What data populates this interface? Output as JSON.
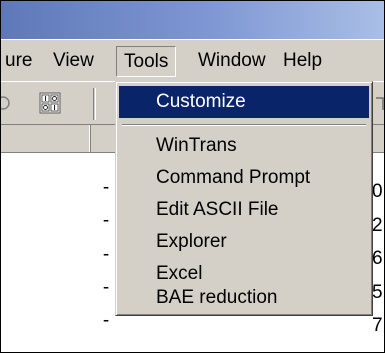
{
  "menubar": {
    "items": [
      {
        "label": "ure"
      },
      {
        "label": "View"
      },
      {
        "label": "Tools"
      },
      {
        "label": "Window"
      },
      {
        "label": "Help"
      }
    ]
  },
  "tools_menu": {
    "items": [
      {
        "label": "Customize",
        "highlighted": true
      },
      {
        "label": "WinTrans"
      },
      {
        "label": "Command Prompt"
      },
      {
        "label": "Edit ASCII File"
      },
      {
        "label": "Explorer"
      },
      {
        "label": "Excel"
      },
      {
        "label": "BAE reduction"
      }
    ]
  },
  "list": {
    "dash_values": [
      "-",
      "-",
      "-",
      "-",
      "-"
    ],
    "right_digits": [
      "0",
      "2",
      "6",
      "5",
      "7"
    ]
  },
  "colors": {
    "titlebar_start": "#5f78b8",
    "titlebar_end": "#a9bfe6",
    "chrome": "#d4d0c8",
    "highlight": "#0a246a"
  }
}
